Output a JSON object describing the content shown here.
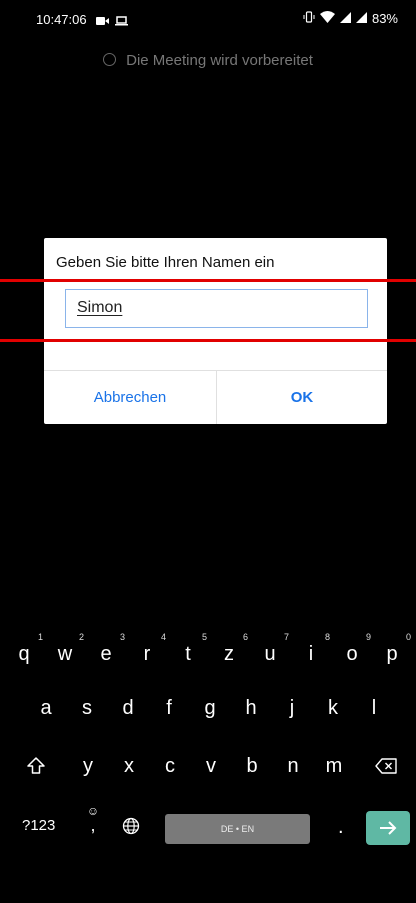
{
  "status_bar": {
    "time": "10:47:06",
    "battery": "83%",
    "left_icons": [
      "video-camera-icon",
      "laptop-icon"
    ],
    "right_icons": [
      "vibrate-icon",
      "wifi-icon",
      "signal-icon",
      "signal-icon"
    ]
  },
  "meeting": {
    "status_text": "Die Meeting wird vorbereitet"
  },
  "dialog": {
    "title": "Geben Sie bitte Ihren Namen ein",
    "name_value": "Simon",
    "cancel_label": "Abbrechen",
    "ok_label": "OK",
    "accent_color": "#1a73e8"
  },
  "keyboard": {
    "row1": [
      {
        "key": "q",
        "hint": "1"
      },
      {
        "key": "w",
        "hint": "2"
      },
      {
        "key": "e",
        "hint": "3"
      },
      {
        "key": "r",
        "hint": "4"
      },
      {
        "key": "t",
        "hint": "5"
      },
      {
        "key": "z",
        "hint": "6"
      },
      {
        "key": "u",
        "hint": "7"
      },
      {
        "key": "i",
        "hint": "8"
      },
      {
        "key": "o",
        "hint": "9"
      },
      {
        "key": "p",
        "hint": "0"
      }
    ],
    "row2": [
      "a",
      "s",
      "d",
      "f",
      "g",
      "h",
      "j",
      "k",
      "l"
    ],
    "row3": [
      "y",
      "x",
      "c",
      "v",
      "b",
      "n",
      "m"
    ],
    "numbers_label": "?123",
    "emoji_comma": ",",
    "space_label": "DE • EN",
    "period_label": ".",
    "enter_color": "#5fb8a4"
  },
  "annotation": {
    "highlight_color": "#e10000"
  }
}
